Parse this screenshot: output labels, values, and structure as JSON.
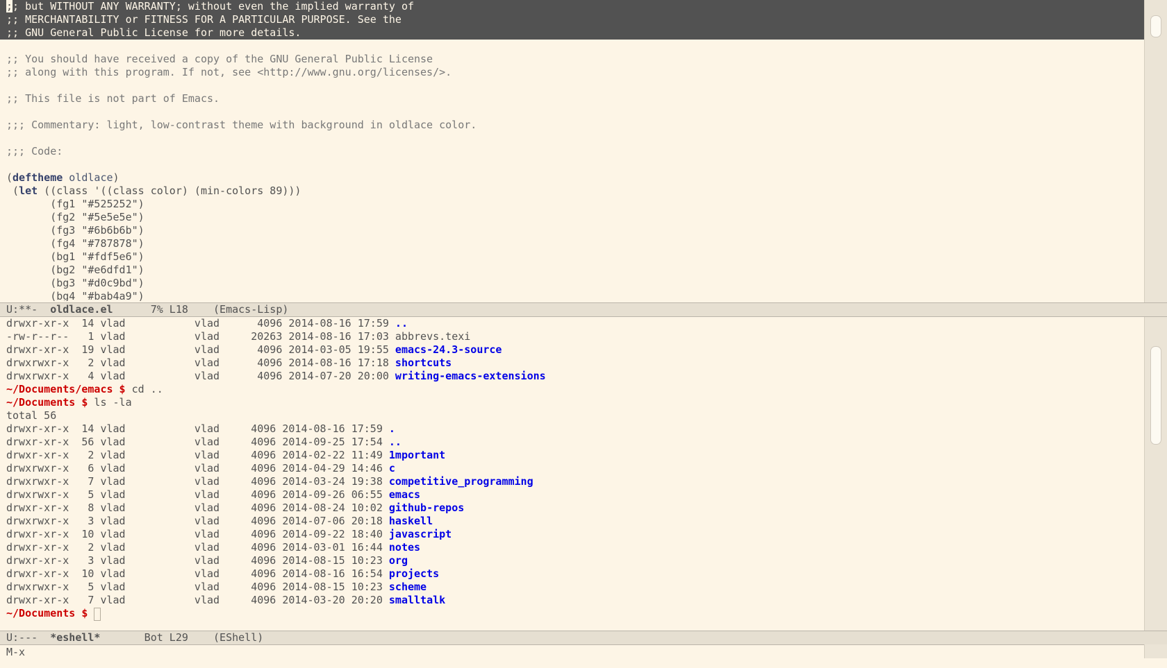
{
  "editor": {
    "selected_lines": [
      {
        "cursor": ";",
        "rest": "; but WITHOUT ANY WARRANTY; without even the implied warranty of"
      },
      {
        "cursor": "",
        "rest": ";; MERCHANTABILITY or FITNESS FOR A PARTICULAR PURPOSE. See the"
      },
      {
        "cursor": "",
        "rest": ";; GNU General Public License for more details."
      }
    ],
    "comment_lines": [
      "",
      ";; You should have received a copy of the GNU General Public License",
      ";; along with this program. If not, see <http://www.gnu.org/licenses/>.",
      "",
      ";; This file is not part of Emacs.",
      "",
      ";;; Commentary: light, low-contrast theme with background in oldlace color.",
      "",
      ";;; Code:",
      ""
    ],
    "deftheme": {
      "open": "(",
      "keyword": "deftheme",
      "name": " oldlace",
      "close": ")"
    },
    "let_line": {
      "indent": " (",
      "keyword": "let",
      "rest": " ((class '((class color) (min-colors 89)))"
    },
    "color_lines": [
      "       (fg1 \"#525252\")",
      "       (fg2 \"#5e5e5e\")",
      "       (fg3 \"#6b6b6b\")",
      "       (fg4 \"#787878\")",
      "       (bg1 \"#fdf5e6\")",
      "       (bg2 \"#e6dfd1\")",
      "       (bg3 \"#d0c9bd\")",
      "       (bg4 \"#bab4a9\")"
    ]
  },
  "modeline_top": {
    "status": "U:**-  ",
    "buffer": "oldlace.el",
    "position": "      7% L18    ",
    "mode": "(Emacs-Lisp)"
  },
  "eshell": {
    "top_listing": [
      {
        "meta": "drwxr-xr-x  14 vlad           vlad      4096 2014-08-16 17:59 ",
        "name": "..",
        "dir": true
      },
      {
        "meta": "-rw-r--r--   1 vlad           vlad     20263 2014-08-16 17:03 ",
        "name": "abbrevs.texi",
        "dir": false
      },
      {
        "meta": "drwxr-xr-x  19 vlad           vlad      4096 2014-03-05 19:55 ",
        "name": "emacs-24.3-source",
        "dir": true
      },
      {
        "meta": "drwxrwxr-x   2 vlad           vlad      4096 2014-08-16 17:18 ",
        "name": "shortcuts",
        "dir": true
      },
      {
        "meta": "drwxrwxr-x   4 vlad           vlad      4096 2014-07-20 20:00 ",
        "name": "writing-emacs-extensions",
        "dir": true
      }
    ],
    "cmd1": {
      "prompt": "~/Documents/emacs $",
      "command": " cd .."
    },
    "cmd2": {
      "prompt": "~/Documents $",
      "command": " ls -la"
    },
    "total": "total 56",
    "listing": [
      {
        "meta": "drwxr-xr-x  14 vlad           vlad     4096 2014-08-16 17:59 ",
        "name": "."
      },
      {
        "meta": "drwxr-xr-x  56 vlad           vlad     4096 2014-09-25 17:54 ",
        "name": ".."
      },
      {
        "meta": "drwxr-xr-x   2 vlad           vlad     4096 2014-02-22 11:49 ",
        "name": "1mportant"
      },
      {
        "meta": "drwxrwxr-x   6 vlad           vlad     4096 2014-04-29 14:46 ",
        "name": "c"
      },
      {
        "meta": "drwxrwxr-x   7 vlad           vlad     4096 2014-03-24 19:38 ",
        "name": "competitive_programming"
      },
      {
        "meta": "drwxrwxr-x   5 vlad           vlad     4096 2014-09-26 06:55 ",
        "name": "emacs"
      },
      {
        "meta": "drwxr-xr-x   8 vlad           vlad     4096 2014-08-24 10:02 ",
        "name": "github-repos"
      },
      {
        "meta": "drwxrwxr-x   3 vlad           vlad     4096 2014-07-06 20:18 ",
        "name": "haskell"
      },
      {
        "meta": "drwxr-xr-x  10 vlad           vlad     4096 2014-09-22 18:40 ",
        "name": "javascript"
      },
      {
        "meta": "drwxr-xr-x   2 vlad           vlad     4096 2014-03-01 16:44 ",
        "name": "notes"
      },
      {
        "meta": "drwxr-xr-x   3 vlad           vlad     4096 2014-08-15 10:23 ",
        "name": "org"
      },
      {
        "meta": "drwxr-xr-x  10 vlad           vlad     4096 2014-08-16 16:54 ",
        "name": "projects"
      },
      {
        "meta": "drwxrwxr-x   5 vlad           vlad     4096 2014-08-15 10:23 ",
        "name": "scheme"
      },
      {
        "meta": "drwxr-xr-x   7 vlad           vlad     4096 2014-03-20 20:20 ",
        "name": "smalltalk"
      }
    ],
    "final_prompt": "~/Documents $"
  },
  "modeline_bottom": {
    "status": "U:---  ",
    "buffer": "*eshell*",
    "position": "       Bot L29    ",
    "mode": "(EShell)"
  },
  "minibuffer": {
    "text": "M-x"
  }
}
